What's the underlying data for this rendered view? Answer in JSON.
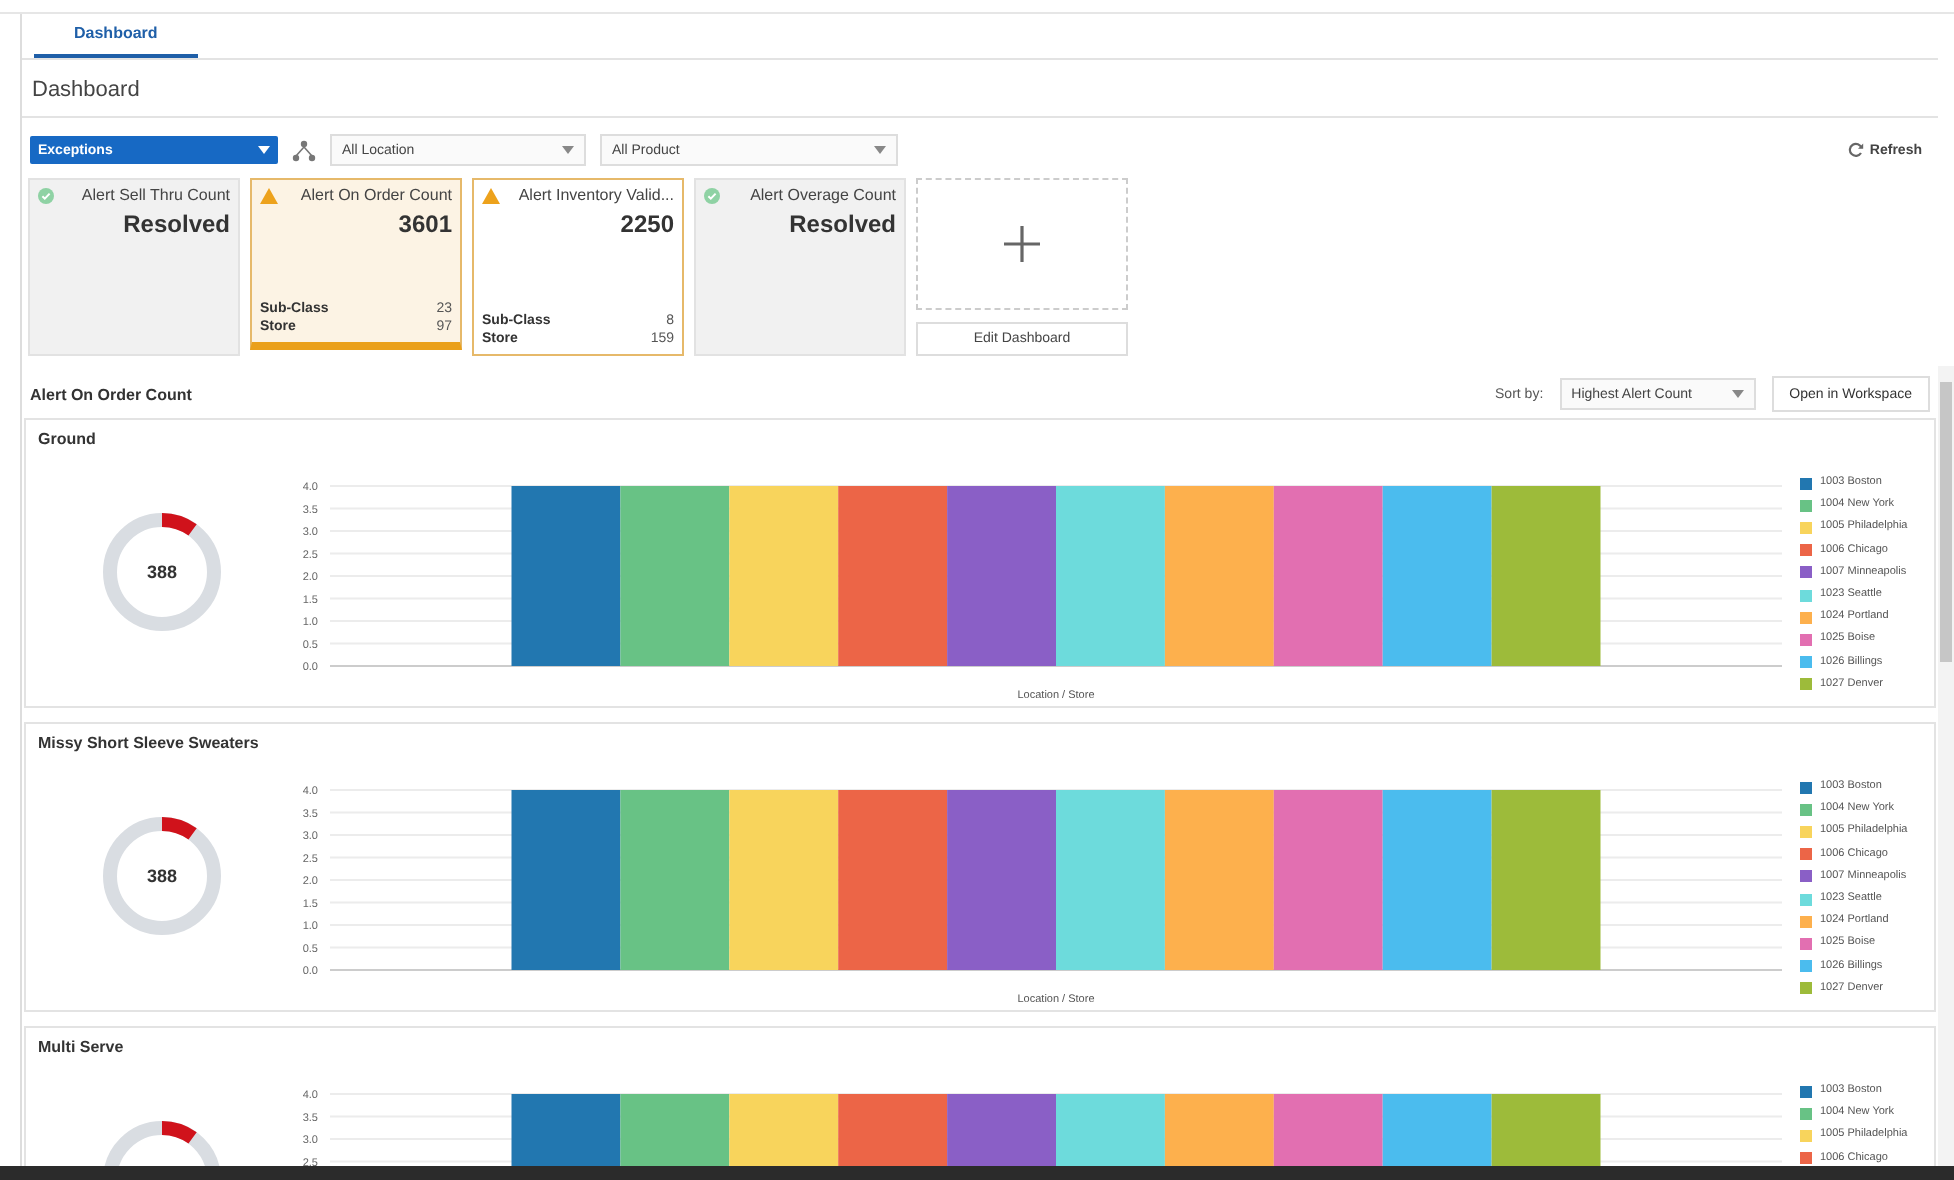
{
  "tabs": [
    {
      "label": "Dashboard",
      "selected": true
    }
  ],
  "page_title": "Dashboard",
  "filters": {
    "exceptions": "Exceptions",
    "location": "All Location",
    "product": "All Product",
    "refresh": "Refresh"
  },
  "tiles": [
    {
      "kind": "resolved",
      "title": "Alert Sell Thru Count",
      "value": "Resolved",
      "selected": false
    },
    {
      "kind": "alert",
      "title": "Alert On Order Count",
      "value": "3601",
      "selected": true,
      "rows": [
        {
          "label": "Sub-Class",
          "count": "23"
        },
        {
          "label": "Store",
          "count": "97"
        }
      ]
    },
    {
      "kind": "alert",
      "title": "Alert Inventory Valid...",
      "value": "2250",
      "selected": false,
      "rows": [
        {
          "label": "Sub-Class",
          "count": "8"
        },
        {
          "label": "Store",
          "count": "159"
        }
      ]
    },
    {
      "kind": "resolved",
      "title": "Alert Overage Count",
      "value": "Resolved",
      "selected": false
    }
  ],
  "add_tile": {
    "button": "Edit Dashboard"
  },
  "section": {
    "title": "Alert On Order Count",
    "sort_label": "Sort by:",
    "sort_value": "Highest Alert Count",
    "open_button": "Open in Workspace"
  },
  "panels": [
    {
      "title": "Ground",
      "donut": {
        "value": "388",
        "level": 0.1
      },
      "chart_data": {
        "type": "bar",
        "xlabel": "Location / Store",
        "grid": true,
        "ylim": [
          0,
          4
        ],
        "yticks": [
          {
            "value": 0,
            "label": "0.0"
          },
          {
            "value": 0.5,
            "label": "0.5"
          },
          {
            "value": 1,
            "label": "1.0"
          },
          {
            "value": 1.5,
            "label": "1.5"
          },
          {
            "value": 2,
            "label": "2.0"
          },
          {
            "value": 2.5,
            "label": "2.5"
          },
          {
            "value": 3,
            "label": "3.0"
          },
          {
            "value": 3.5,
            "label": "3.5"
          },
          {
            "value": 4,
            "label": "4.0"
          }
        ],
        "series": [
          {
            "name": "1003 Boston",
            "color": "#2277b0",
            "values": [
              4
            ]
          },
          {
            "name": "1004 New York",
            "color": "#68c285",
            "values": [
              4
            ]
          },
          {
            "name": "1005 Philadelphia",
            "color": "#f8d45c",
            "values": [
              4
            ]
          },
          {
            "name": "1006 Chicago",
            "color": "#ec6547",
            "values": [
              4
            ]
          },
          {
            "name": "1007 Minneapolis",
            "color": "#8a5fc6",
            "values": [
              4
            ]
          },
          {
            "name": "1023 Seattle",
            "color": "#6ddbdc",
            "values": [
              4
            ]
          },
          {
            "name": "1024 Portland",
            "color": "#fdb04d",
            "values": [
              4
            ]
          },
          {
            "name": "1025 Boise",
            "color": "#e26fb1",
            "values": [
              4
            ]
          },
          {
            "name": "1026 Billings",
            "color": "#4bbcee",
            "values": [
              4
            ]
          },
          {
            "name": "1027 Denver",
            "color": "#9dbb3a",
            "values": [
              4
            ]
          }
        ]
      }
    },
    {
      "title": "Missy Short Sleeve Sweaters",
      "donut": {
        "value": "388",
        "level": 0.1
      },
      "chart_data": {
        "type": "bar",
        "xlabel": "Location / Store",
        "grid": true,
        "ylim": [
          0,
          4
        ],
        "yticks": [
          {
            "value": 0,
            "label": "0.0"
          },
          {
            "value": 0.5,
            "label": "0.5"
          },
          {
            "value": 1,
            "label": "1.0"
          },
          {
            "value": 1.5,
            "label": "1.5"
          },
          {
            "value": 2,
            "label": "2.0"
          },
          {
            "value": 2.5,
            "label": "2.5"
          },
          {
            "value": 3,
            "label": "3.0"
          },
          {
            "value": 3.5,
            "label": "3.5"
          },
          {
            "value": 4,
            "label": "4.0"
          }
        ],
        "series": [
          {
            "name": "1003 Boston",
            "color": "#2277b0",
            "values": [
              4
            ]
          },
          {
            "name": "1004 New York",
            "color": "#68c285",
            "values": [
              4
            ]
          },
          {
            "name": "1005 Philadelphia",
            "color": "#f8d45c",
            "values": [
              4
            ]
          },
          {
            "name": "1006 Chicago",
            "color": "#ec6547",
            "values": [
              4
            ]
          },
          {
            "name": "1007 Minneapolis",
            "color": "#8a5fc6",
            "values": [
              4
            ]
          },
          {
            "name": "1023 Seattle",
            "color": "#6ddbdc",
            "values": [
              4
            ]
          },
          {
            "name": "1024 Portland",
            "color": "#fdb04d",
            "values": [
              4
            ]
          },
          {
            "name": "1025 Boise",
            "color": "#e26fb1",
            "values": [
              4
            ]
          },
          {
            "name": "1026 Billings",
            "color": "#4bbcee",
            "values": [
              4
            ]
          },
          {
            "name": "1027 Denver",
            "color": "#9dbb3a",
            "values": [
              4
            ]
          }
        ]
      }
    },
    {
      "title": "Multi Serve",
      "donut": {
        "level": 0.1
      },
      "chart_data": {
        "type": "bar",
        "grid": true,
        "ylim": [
          0,
          4
        ],
        "yticks": [
          {
            "value": 2.5,
            "label": "2.5"
          },
          {
            "value": 3,
            "label": "3.0"
          },
          {
            "value": 3.5,
            "label": "3.5"
          },
          {
            "value": 4,
            "label": "4.0"
          }
        ],
        "series": [
          {
            "name": "1003 Boston",
            "color": "#2277b0",
            "values": [
              4
            ]
          },
          {
            "name": "1004 New York",
            "color": "#68c285",
            "values": [
              4
            ]
          },
          {
            "name": "1005 Philadelphia",
            "color": "#f8d45c",
            "values": [
              4
            ]
          },
          {
            "name": "1006 Chicago",
            "color": "#ec6547",
            "values": [
              4
            ]
          },
          {
            "color": "#8a5fc6",
            "values": [
              4
            ]
          },
          {
            "color": "#6ddbdc",
            "values": [
              4
            ]
          },
          {
            "color": "#fdb04d",
            "values": [
              4
            ]
          },
          {
            "color": "#e26fb1",
            "values": [
              4
            ]
          },
          {
            "color": "#4bbcee",
            "values": [
              4
            ]
          },
          {
            "color": "#9dbb3a",
            "values": [
              4
            ]
          }
        ]
      }
    }
  ]
}
